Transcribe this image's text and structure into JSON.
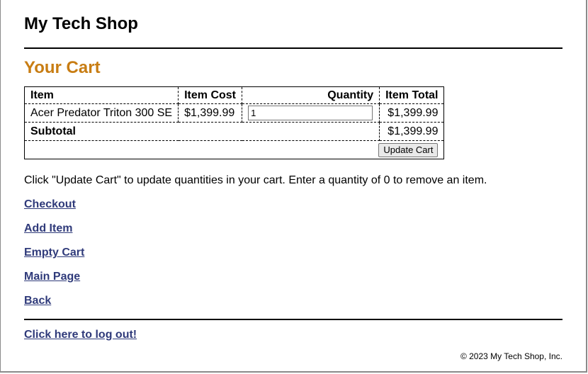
{
  "site": {
    "title": "My Tech Shop"
  },
  "cart": {
    "heading": "Your Cart",
    "columns": {
      "item": "Item",
      "cost": "Item Cost",
      "quantity": "Quantity",
      "total": "Item Total"
    },
    "rows": [
      {
        "item": "Acer Predator Triton 300 SE",
        "cost": "$1,399.99",
        "quantity": "1",
        "total": "$1,399.99"
      }
    ],
    "subtotal_label": "Subtotal",
    "subtotal_value": "$1,399.99",
    "update_button": "Update Cart"
  },
  "instructions": "Click \"Update Cart\" to update quantities in your cart. Enter a quantity of 0 to remove an item.",
  "links": {
    "checkout": "Checkout",
    "add_item": "Add Item",
    "empty_cart": "Empty Cart",
    "main_page": "Main Page",
    "back": "Back",
    "logout": "Click here to log out!"
  },
  "footer": {
    "copyright": "© 2023 My Tech Shop, Inc."
  },
  "colors": {
    "heading_accent": "#c87d13",
    "link": "#2f3a7a"
  }
}
